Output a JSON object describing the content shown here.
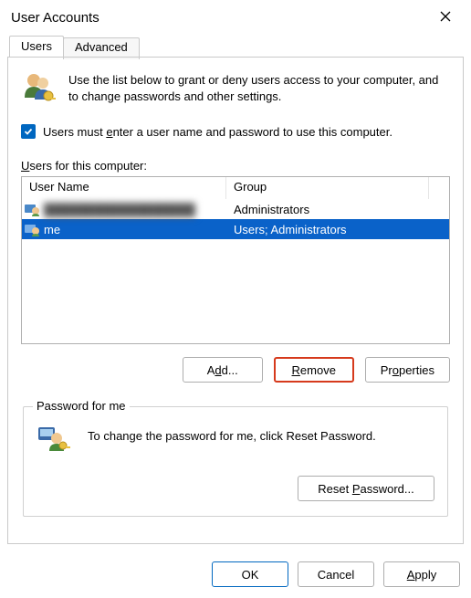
{
  "title": "User Accounts",
  "tabs": {
    "users": "Users",
    "advanced": "Advanced"
  },
  "intro": "Use the list below to grant or deny users access to your computer, and to change passwords and other settings.",
  "checkbox_label_pre": "Users must ",
  "checkbox_label_uchar": "e",
  "checkbox_label_post": "nter a user name and password to use this computer.",
  "list_label_uchar": "U",
  "list_label_post": "sers for this computer:",
  "columns": {
    "username": "User Name",
    "group": "Group"
  },
  "rows": [
    {
      "username": "██████████████████",
      "group": "Administrators",
      "selected": false,
      "obscured": true
    },
    {
      "username": "me",
      "group": "Users; Administrators",
      "selected": true,
      "obscured": false
    }
  ],
  "buttons": {
    "add_pre": "A",
    "add_u": "d",
    "add_post": "d...",
    "remove_pre": "",
    "remove_u": "R",
    "remove_post": "emove",
    "props_pre": "Pr",
    "props_u": "o",
    "props_post": "perties"
  },
  "pw_group": {
    "legend": "Password for me",
    "text": "To change the password for me, click Reset Password.",
    "button_pre": "Reset ",
    "button_u": "P",
    "button_post": "assword..."
  },
  "footer": {
    "ok": "OK",
    "cancel": "Cancel",
    "apply_u": "A",
    "apply_post": "pply"
  }
}
